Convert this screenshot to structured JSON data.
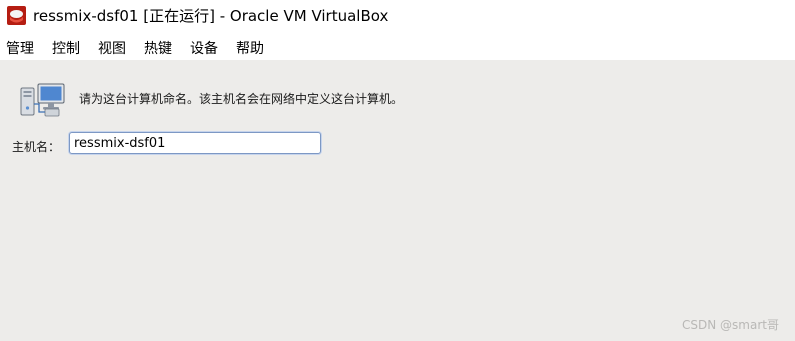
{
  "window": {
    "title": "ressmix-dsf01 [正在运行] - Oracle VM VirtualBox",
    "icon": "virtualbox-icon"
  },
  "menu": {
    "items": [
      "管理",
      "控制",
      "视图",
      "热键",
      "设备",
      "帮助"
    ]
  },
  "guest": {
    "icon": "network-computers-icon",
    "instruction": "请为这台计算机命名。该主机名会在网络中定义这台计算机。",
    "hostname_label": "主机名：",
    "hostname_value": "ressmix-dsf01",
    "watermark": "CSDN @smart哥"
  },
  "colors": {
    "guest_background": "#edecea",
    "input_border": "#7d98c4"
  }
}
